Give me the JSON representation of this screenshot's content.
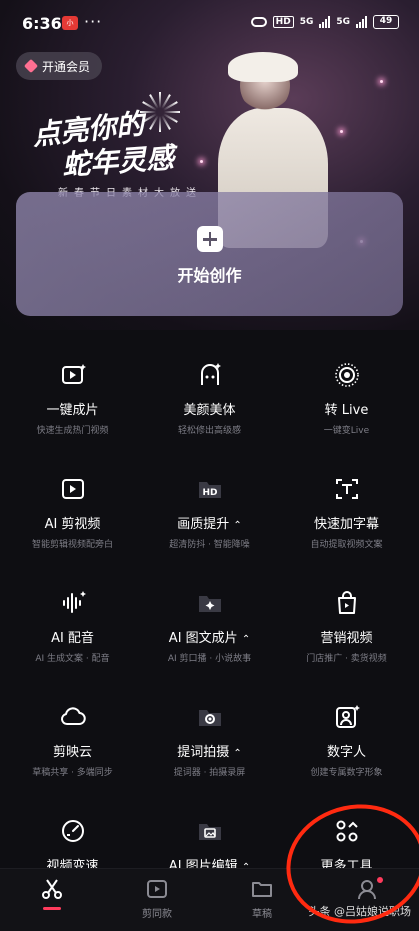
{
  "status_bar": {
    "time": "6:36",
    "app_badge": "小",
    "more": "···",
    "hd": "HD",
    "signal1": "5G",
    "signal2": "5G",
    "battery": "49"
  },
  "vip": {
    "label": "开通会员",
    "icon": "diamond-icon"
  },
  "hero": {
    "line1": "点亮你的",
    "line2": "蛇年灵感",
    "subtitle": "新春节日素材大放送"
  },
  "create": {
    "label": "开始创作",
    "icon": "plus-icon"
  },
  "tools": [
    {
      "title": "一键成片",
      "subtitle": "快速生成热门视频",
      "icon": "video-spark-icon"
    },
    {
      "title": "美颜美体",
      "subtitle": "轻松修出高级感",
      "icon": "face-beauty-icon"
    },
    {
      "title": "转 Live",
      "subtitle": "一键变Live",
      "icon": "live-photo-icon"
    },
    {
      "title": "AI 剪视频",
      "subtitle": "智能剪辑视频配旁白",
      "icon": "ai-video-icon"
    },
    {
      "title": "画质提升",
      "subtitle": "超清防抖 · 智能降噪",
      "icon": "hd-folder-icon",
      "chevron": "⌃"
    },
    {
      "title": "快速加字幕",
      "subtitle": "自动提取视频文案",
      "icon": "subtitle-icon"
    },
    {
      "title": "AI 配音",
      "subtitle": "AI 生成文案 · 配音",
      "icon": "waveform-icon"
    },
    {
      "title": "AI 图文成片",
      "subtitle": "AI 剪口播 · 小说故事",
      "icon": "image-text-icon",
      "chevron": "⌃"
    },
    {
      "title": "营销视频",
      "subtitle": "门店推广 · 卖货视频",
      "icon": "shopping-bag-icon"
    },
    {
      "title": "剪映云",
      "subtitle": "草稿共享 · 多端同步",
      "icon": "cloud-icon"
    },
    {
      "title": "提词拍摄",
      "subtitle": "提词器 · 拍摄录屏",
      "icon": "teleprompter-icon",
      "chevron": "⌃"
    },
    {
      "title": "数字人",
      "subtitle": "创建专属数字形象",
      "icon": "digital-human-icon"
    },
    {
      "title": "视频变速",
      "subtitle": "",
      "icon": "speedometer-icon"
    },
    {
      "title": "AI 图片编辑",
      "subtitle": "",
      "icon": "image-edit-icon",
      "chevron": "⌃"
    },
    {
      "title": "更多工具",
      "subtitle": "",
      "icon": "more-tools-icon"
    }
  ],
  "nav": [
    {
      "label": "",
      "icon": "scissors-icon",
      "active": true
    },
    {
      "label": "剪同款",
      "icon": "template-video-icon"
    },
    {
      "label": "草稿",
      "icon": "folder-icon"
    },
    {
      "label": "",
      "icon": "profile-icon"
    }
  ],
  "watermark": "头条 @吕姑娘说职场",
  "colors": {
    "accent": "#ff3b5c",
    "background": "#0e0e12",
    "annotation": "#ff2a10"
  }
}
